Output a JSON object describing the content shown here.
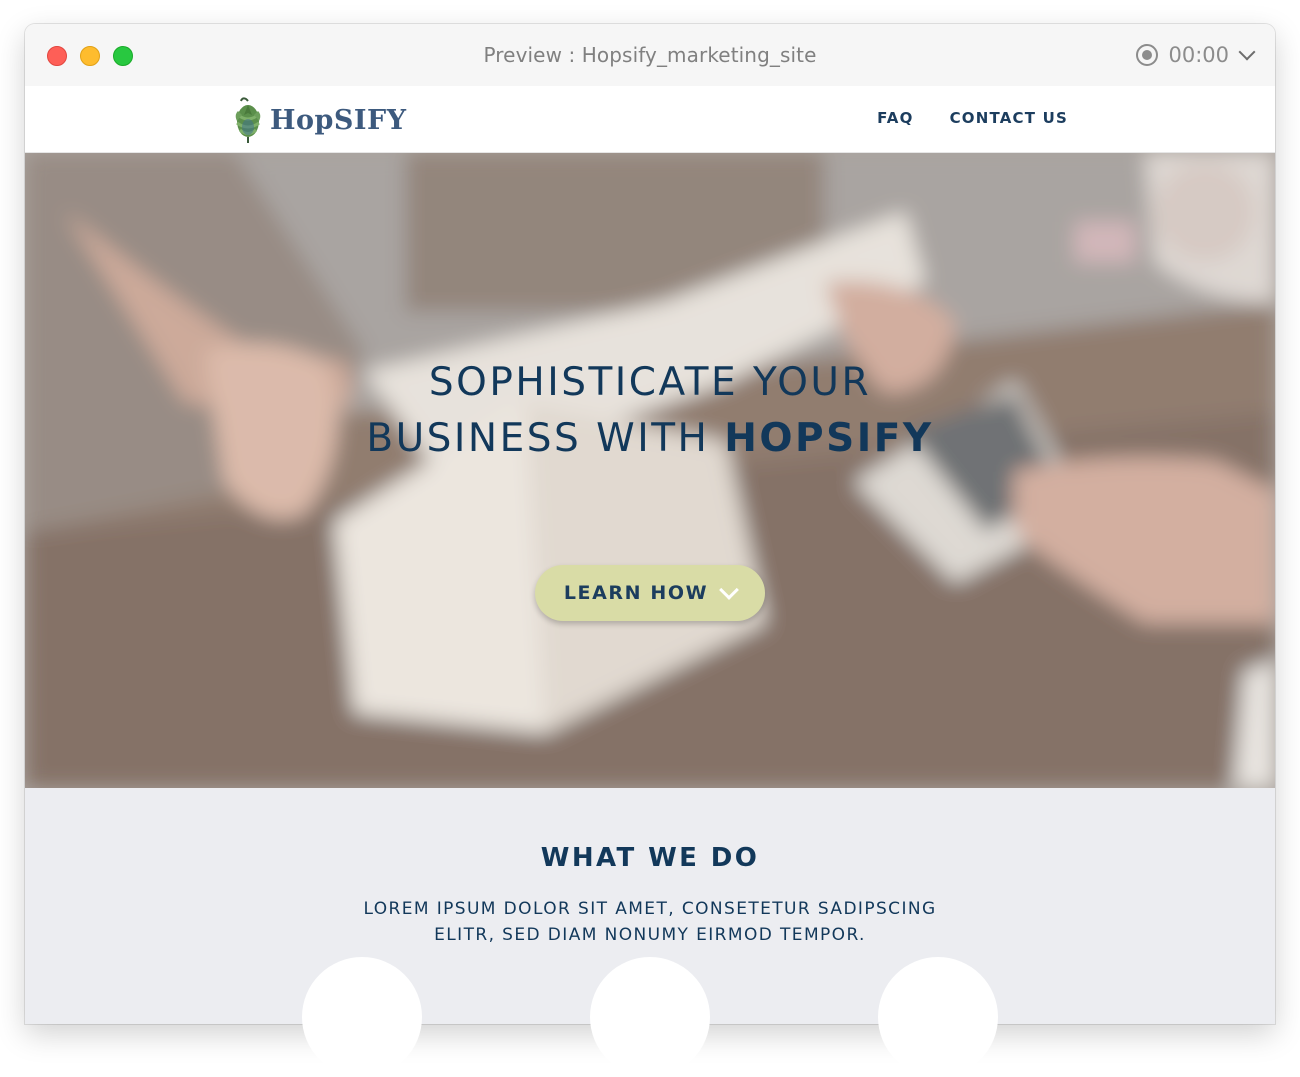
{
  "window": {
    "title": "Preview : Hopsify_marketing_site",
    "recorder_time": "00:00"
  },
  "site": {
    "logo_text": "HopSIFY",
    "nav": [
      "FAQ",
      "CONTACT US"
    ]
  },
  "hero": {
    "title_line1": "SOPHISTICATE YOUR",
    "title_line2_prefix": "BUSINESS WITH ",
    "title_line2_brand": "HOPSIFY",
    "cta_label": "LEARN HOW"
  },
  "what_we_do": {
    "title": "WHAT WE DO",
    "subtitle_line1": "LOREM IPSUM DOLOR SIT AMET, CONSETETUR SADIPSCING",
    "subtitle_line2": "ELITR, SED DIAM NONUMY EIRMOD TEMPOR."
  },
  "colors": {
    "navy": "#12385a",
    "cta_bg": "#d9dca6",
    "section_bg": "#ecedf1"
  }
}
